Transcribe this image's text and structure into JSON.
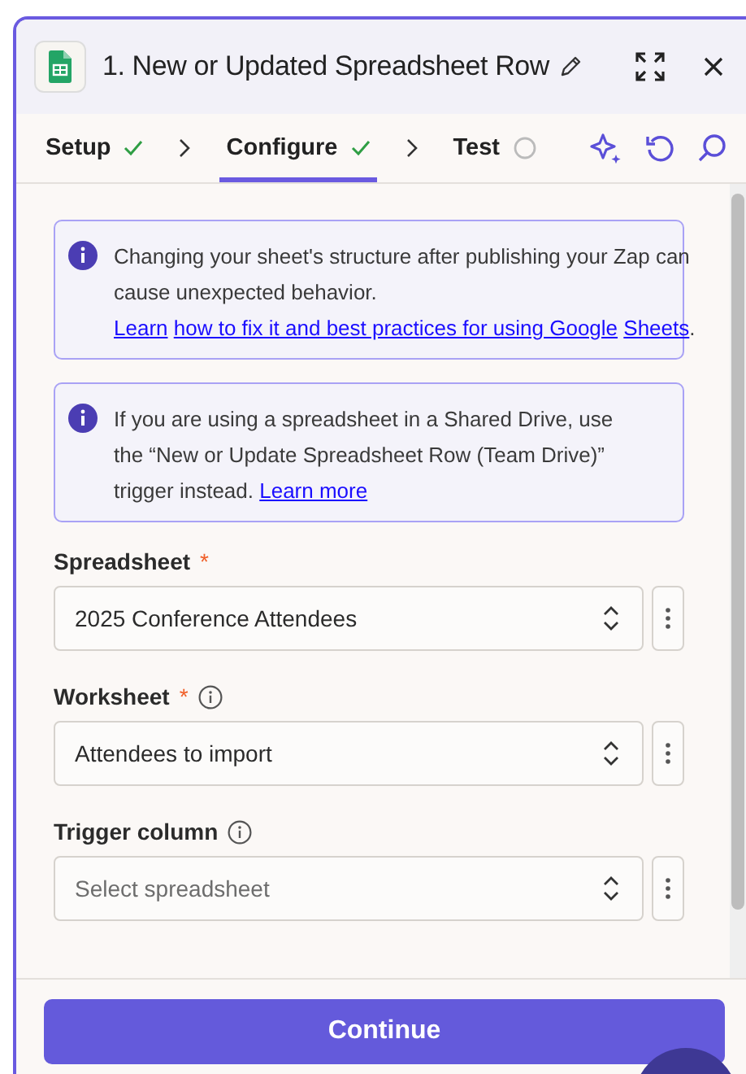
{
  "header": {
    "title": "1. New or Updated Spreadsheet Row"
  },
  "tabs": [
    {
      "label": "Setup",
      "selected": false,
      "done": true
    },
    {
      "label": "Configure",
      "selected": true,
      "done": true
    },
    {
      "label": "Test",
      "selected": false,
      "done": false
    }
  ],
  "notes": [
    {
      "segments": [
        {
          "text": "Changing your sheet's structure after publishing your Zap can cause unexpected behavior. ",
          "kind": "text"
        },
        {
          "text": "Learn",
          "kind": "link"
        },
        {
          "text": "how to fix it and best practices for using Google",
          "kind": "link"
        },
        {
          "text": "Sheets",
          "kind": "link"
        },
        {
          "text": ".",
          "kind": "text"
        }
      ]
    },
    {
      "segments": [
        {
          "text": "If you are using a spreadsheet in a Shared Drive, use the “New or Update Spreadsheet Row (Team Drive)” trigger instead. ",
          "kind": "text"
        },
        {
          "text": "Learn more",
          "kind": "link"
        }
      ]
    }
  ],
  "fields": [
    {
      "label": "Spreadsheet",
      "required": true,
      "info": false,
      "value": "2025 Conference Attendees"
    },
    {
      "label": "Worksheet",
      "required": true,
      "info": true,
      "value": "Attendees to import"
    },
    {
      "label": "Trigger column",
      "required": false,
      "info": true,
      "placeholder": "Select spreadsheet"
    }
  ],
  "required_mark": "*",
  "continue_button": "Continue"
}
